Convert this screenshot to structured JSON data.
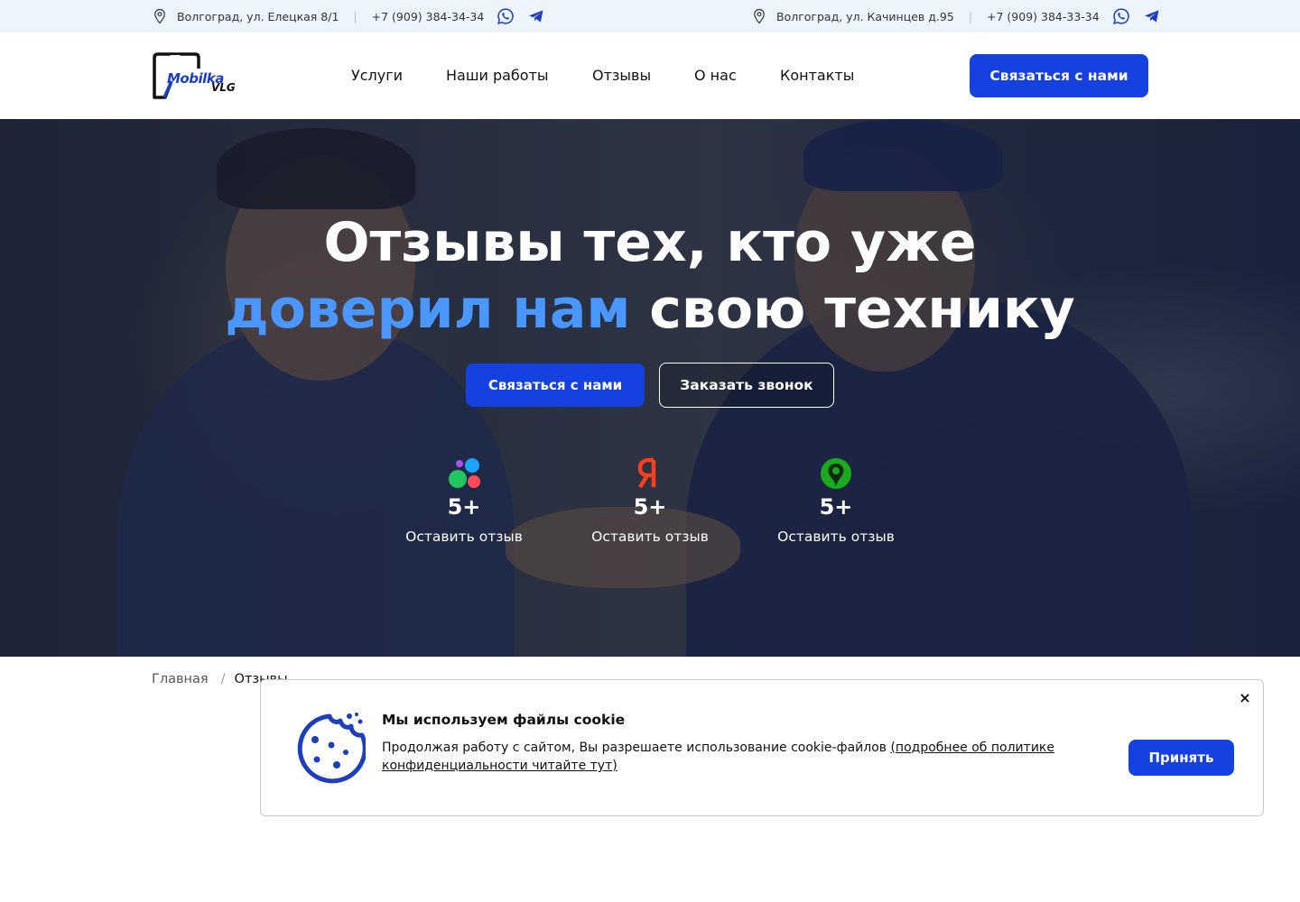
{
  "topbar": {
    "left": {
      "address": "Волгоград, ул. Елецкая 8/1",
      "phone": "+7 (909) 384-34-34"
    },
    "right": {
      "address": "Волгоград, ул. Качинцев д.95",
      "phone": "+7 (909) 384-33-34"
    },
    "separator": "|"
  },
  "header": {
    "logo": {
      "brand": "Mobilka",
      "sub": "VLG"
    },
    "nav": [
      "Услуги",
      "Наши работы",
      "Отзывы",
      "О нас",
      "Контакты"
    ],
    "cta": "Связаться с нами"
  },
  "hero": {
    "title_line1": "Отзывы тех, кто уже",
    "title_accent": "доверил нам",
    "title_rest": " свою технику",
    "btn_contact": "Связаться с нами",
    "btn_call": "Заказать звонок",
    "stats": [
      {
        "icon": "flamp-icon",
        "count": "5+",
        "link": "Оставить отзыв"
      },
      {
        "icon": "yandex-icon",
        "count": "5+",
        "link": "Оставить отзыв"
      },
      {
        "icon": "2gis-icon",
        "count": "5+",
        "link": "Оставить отзыв"
      }
    ],
    "accent_color": "#4a98ff"
  },
  "breadcrumb": {
    "home": "Главная",
    "sep": "/",
    "current": "Отзывы"
  },
  "cookie": {
    "title": "Мы используем файлы cookie",
    "text": "Продолжая работу с сайтом, Вы разрешаете использование cookie-файлов ",
    "link": "(подробнее об политике конфиденциальности читайте тут)",
    "accept": "Принять",
    "close": "×"
  },
  "colors": {
    "primary": "#1541e0",
    "topbar_bg": "#eef4fc"
  }
}
